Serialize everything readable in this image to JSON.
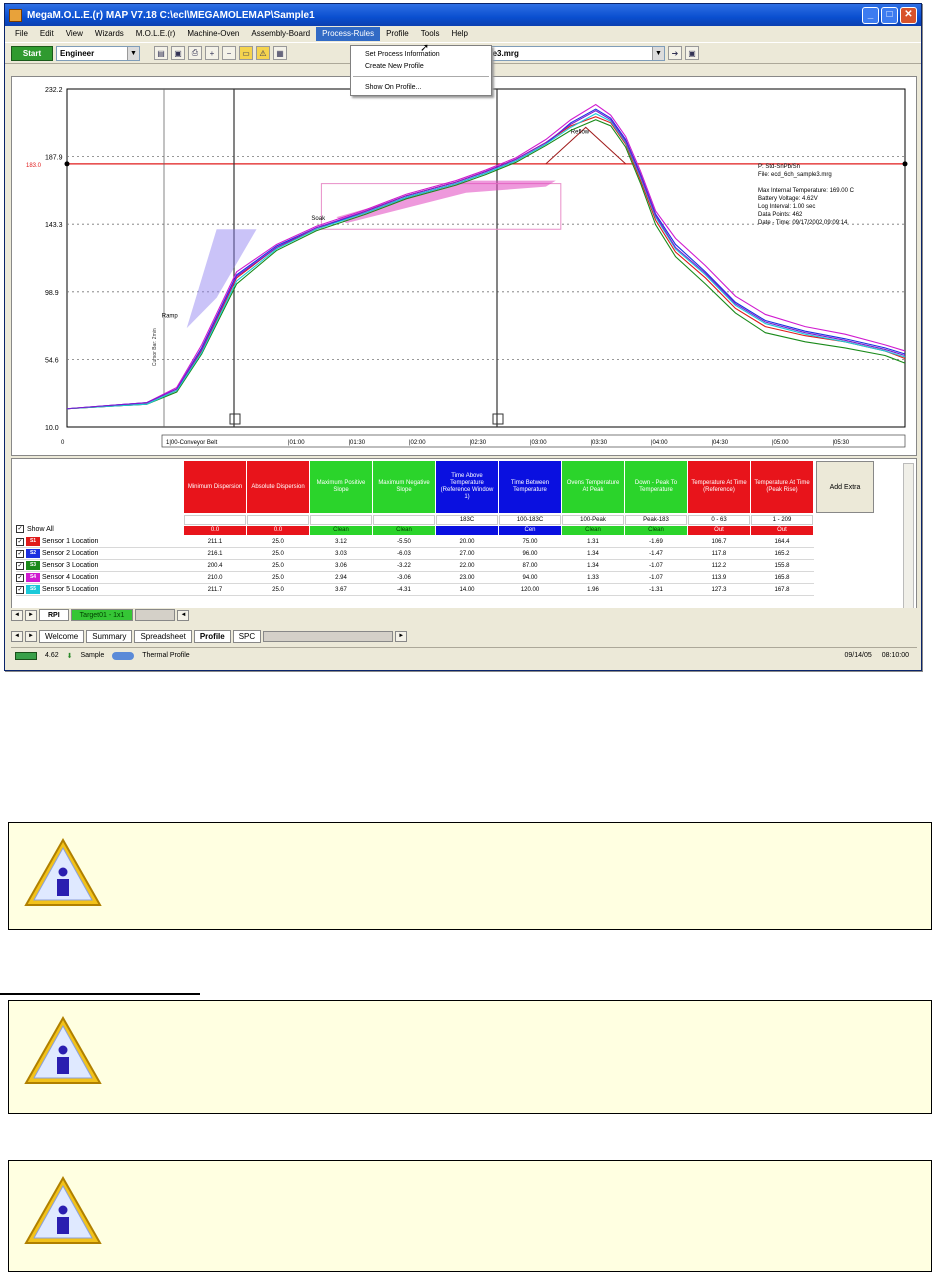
{
  "window": {
    "title": "MegaM.O.L.E.(r) MAP V7.18  C:\\ecl\\MEGAMOLEMAP\\Sample1",
    "menu": [
      "File",
      "Edit",
      "View",
      "Wizards",
      "M.O.L.E.(r)",
      "Machine-Oven",
      "Assembly-Board",
      "Process-Rules",
      "Profile",
      "Tools",
      "Help"
    ],
    "active_menu": "Process-Rules",
    "dropdown": [
      "Set Process Information",
      "Create New Profile",
      "Show On Profile..."
    ],
    "toolbar": {
      "start": "Start",
      "user_combo": "Engineer",
      "file_combo": "ecd_6ch_sample3.mrg"
    }
  },
  "info_panel": [
    "P: Std-SnPb/Sn",
    "File: ecd_6ch_sample3.mrg",
    "",
    "Max Internal Temperature: 169.00 C",
    "Battery Voltage: 4.62V",
    "Log Interval: 1.00 sec",
    "Data Points: 462",
    "Date - Time: 09/17/2002 09:09:14"
  ],
  "chart_data": {
    "type": "line",
    "y_ticks": [
      "232.2",
      "187.9",
      "143.3",
      "98.9",
      "54.6",
      "10.0"
    ],
    "y_red_label": "183.0",
    "x_ticks": [
      "0",
      "|00:00",
      "|01:00",
      "|01:30",
      "|02:00",
      "|02:30",
      "|03:00",
      "|03:30",
      "|04:00",
      "|04:30",
      "|05:00",
      "|05:30"
    ],
    "x_first_tick": "1|00-Conveyor Belt",
    "ylim": [
      10.0,
      232.2
    ],
    "red_line": 183.0,
    "annotations": [
      "Ramp",
      "Soak",
      "Reflow",
      "Cursor Bar: 2min"
    ],
    "series_colors": [
      "#e01b1b",
      "#1b2fe0",
      "#1a8a1a",
      "#d01bd0",
      "#1bc9d9",
      "#7a1bd0"
    ],
    "series": [
      {
        "values": [
          [
            0,
            22
          ],
          [
            80,
            25
          ],
          [
            110,
            34
          ],
          [
            135,
            60
          ],
          [
            170,
            108
          ],
          [
            210,
            128
          ],
          [
            250,
            140
          ],
          [
            300,
            152
          ],
          [
            340,
            162
          ],
          [
            390,
            171
          ],
          [
            420,
            178
          ],
          [
            450,
            186
          ],
          [
            480,
            197
          ],
          [
            505,
            208
          ],
          [
            530,
            214
          ],
          [
            545,
            210
          ],
          [
            560,
            196
          ],
          [
            575,
            172
          ],
          [
            590,
            146
          ],
          [
            610,
            125
          ],
          [
            640,
            108
          ],
          [
            670,
            88
          ],
          [
            700,
            76
          ],
          [
            740,
            70
          ],
          [
            780,
            66
          ],
          [
            820,
            60
          ],
          [
            840,
            55
          ]
        ]
      },
      {
        "values": [
          [
            0,
            22
          ],
          [
            80,
            26
          ],
          [
            110,
            35
          ],
          [
            135,
            62
          ],
          [
            170,
            110
          ],
          [
            210,
            129
          ],
          [
            250,
            141
          ],
          [
            300,
            151
          ],
          [
            340,
            161
          ],
          [
            390,
            170
          ],
          [
            420,
            177
          ],
          [
            450,
            185
          ],
          [
            480,
            196
          ],
          [
            505,
            210
          ],
          [
            530,
            219
          ],
          [
            545,
            213
          ],
          [
            560,
            199
          ],
          [
            575,
            176
          ],
          [
            590,
            150
          ],
          [
            610,
            130
          ],
          [
            640,
            112
          ],
          [
            670,
            92
          ],
          [
            700,
            80
          ],
          [
            740,
            73
          ],
          [
            780,
            68
          ],
          [
            820,
            62
          ],
          [
            840,
            58
          ]
        ]
      },
      {
        "values": [
          [
            0,
            22
          ],
          [
            80,
            25
          ],
          [
            110,
            33
          ],
          [
            135,
            58
          ],
          [
            170,
            104
          ],
          [
            210,
            126
          ],
          [
            250,
            139
          ],
          [
            300,
            150
          ],
          [
            340,
            160
          ],
          [
            390,
            169
          ],
          [
            420,
            176
          ],
          [
            450,
            184
          ],
          [
            480,
            195
          ],
          [
            505,
            205
          ],
          [
            530,
            212
          ],
          [
            545,
            208
          ],
          [
            560,
            194
          ],
          [
            575,
            170
          ],
          [
            590,
            143
          ],
          [
            610,
            122
          ],
          [
            640,
            104
          ],
          [
            670,
            85
          ],
          [
            700,
            72
          ],
          [
            740,
            66
          ],
          [
            780,
            62
          ],
          [
            820,
            57
          ],
          [
            840,
            52
          ]
        ]
      },
      {
        "values": [
          [
            0,
            22
          ],
          [
            80,
            26
          ],
          [
            110,
            36
          ],
          [
            135,
            64
          ],
          [
            170,
            112
          ],
          [
            210,
            130
          ],
          [
            250,
            142
          ],
          [
            300,
            153
          ],
          [
            340,
            163
          ],
          [
            390,
            172
          ],
          [
            420,
            179
          ],
          [
            450,
            187
          ],
          [
            480,
            199
          ],
          [
            505,
            212
          ],
          [
            530,
            222
          ],
          [
            545,
            215
          ],
          [
            560,
            201
          ],
          [
            575,
            178
          ],
          [
            590,
            152
          ],
          [
            610,
            134
          ],
          [
            640,
            116
          ],
          [
            670,
            96
          ],
          [
            700,
            84
          ],
          [
            740,
            76
          ],
          [
            780,
            71
          ],
          [
            820,
            64
          ],
          [
            840,
            60
          ]
        ]
      },
      {
        "values": [
          [
            0,
            22
          ],
          [
            80,
            25
          ],
          [
            110,
            34
          ],
          [
            135,
            59
          ],
          [
            170,
            106
          ],
          [
            210,
            127
          ],
          [
            250,
            140
          ],
          [
            300,
            151
          ],
          [
            340,
            161
          ],
          [
            390,
            170
          ],
          [
            420,
            177
          ],
          [
            450,
            185
          ],
          [
            480,
            196
          ],
          [
            505,
            207
          ],
          [
            530,
            216
          ],
          [
            545,
            211
          ],
          [
            560,
            197
          ],
          [
            575,
            174
          ],
          [
            590,
            148
          ],
          [
            610,
            127
          ],
          [
            640,
            110
          ],
          [
            670,
            90
          ],
          [
            700,
            78
          ],
          [
            740,
            71
          ],
          [
            780,
            66
          ],
          [
            820,
            60
          ],
          [
            840,
            56
          ]
        ]
      },
      {
        "values": [
          [
            0,
            22
          ],
          [
            80,
            26
          ],
          [
            110,
            35
          ],
          [
            135,
            61
          ],
          [
            170,
            109
          ],
          [
            210,
            128
          ],
          [
            250,
            141
          ],
          [
            300,
            152
          ],
          [
            340,
            162
          ],
          [
            390,
            171
          ],
          [
            420,
            178
          ],
          [
            450,
            186
          ],
          [
            480,
            197
          ],
          [
            505,
            209
          ],
          [
            530,
            218
          ],
          [
            545,
            212
          ],
          [
            560,
            198
          ],
          [
            575,
            175
          ],
          [
            590,
            149
          ],
          [
            610,
            128
          ],
          [
            640,
            111
          ],
          [
            670,
            91
          ],
          [
            700,
            79
          ],
          [
            740,
            72
          ],
          [
            780,
            67
          ],
          [
            820,
            61
          ],
          [
            840,
            57
          ]
        ]
      }
    ]
  },
  "table": {
    "headers": [
      {
        "label": "Minimum Dispersion",
        "color": "r"
      },
      {
        "label": "Absolute Dispersion",
        "color": "r"
      },
      {
        "label": "Maximum Positive Slope",
        "color": "g"
      },
      {
        "label": "Maximum Negative Slope",
        "color": "g"
      },
      {
        "label": "Time Above Temperature (Reference Window 1)",
        "color": "b"
      },
      {
        "label": "Time Between Temperature",
        "color": "b"
      },
      {
        "label": "Ovens Temperature At Peak",
        "color": "g"
      },
      {
        "label": "Down - Peak To Temperature",
        "color": "g"
      },
      {
        "label": "Temperature At Time (Reference)",
        "color": "r"
      },
      {
        "label": "Temperature At Time (Peak Rise)",
        "color": "r"
      }
    ],
    "add_extra": "Add Extra",
    "specs": [
      "",
      "",
      "",
      "",
      "183C",
      "100-183C",
      "100-Peak",
      "Peak-183",
      "0 - 63",
      "1 - 209"
    ],
    "stats": [
      {
        "t": "0.0",
        "c": "r"
      },
      {
        "t": "0.0",
        "c": "r"
      },
      {
        "t": "Clean",
        "c": "g"
      },
      {
        "t": "Clean",
        "c": "g"
      },
      {
        "t": "",
        "c": "b"
      },
      {
        "t": "Cen",
        "c": "b"
      },
      {
        "t": "Clean",
        "c": "g"
      },
      {
        "t": "Clean",
        "c": "g"
      },
      {
        "t": "Out",
        "c": "r"
      },
      {
        "t": "Out",
        "c": "r"
      }
    ],
    "show_all": "Show All",
    "rows": [
      {
        "sw": "S1",
        "color": "#e01b1b",
        "label": "Sensor 1 Location",
        "values": [
          "211.1",
          "25.0",
          "3.12",
          "-5.50",
          "20.00",
          "75.00",
          "1.31",
          "-1.69",
          "106.7",
          "164.4"
        ]
      },
      {
        "sw": "S2",
        "color": "#1b2fe0",
        "label": "Sensor 2 Location",
        "values": [
          "216.1",
          "25.0",
          "3.03",
          "-6.03",
          "27.00",
          "96.00",
          "1.34",
          "-1.47",
          "117.8",
          "165.2"
        ]
      },
      {
        "sw": "S3",
        "color": "#1a8a1a",
        "label": "Sensor 3 Location",
        "values": [
          "200.4",
          "25.0",
          "3.06",
          "-3.22",
          "22.00",
          "87.00",
          "1.34",
          "-1.07",
          "112.2",
          "155.8"
        ]
      },
      {
        "sw": "S4",
        "color": "#d01bd0",
        "label": "Sensor 4 Location",
        "values": [
          "210.0",
          "25.0",
          "2.94",
          "-3.06",
          "23.00",
          "94.00",
          "1.33",
          "-1.07",
          "113.9",
          "165.8"
        ]
      },
      {
        "sw": "S5",
        "color": "#1bc9d9",
        "label": "Sensor 5 Location",
        "values": [
          "211.7",
          "25.0",
          "3.67",
          "-4.31",
          "14.00",
          "120.00",
          "1.96",
          "-1.31",
          "127.3",
          "167.8"
        ]
      }
    ]
  },
  "sheet_tabs": [
    "RPI",
    "Target01 - 1x1",
    ""
  ],
  "doc_tabs": [
    "Welcome",
    "Summary",
    "Spreadsheet",
    "Profile",
    "SPC"
  ],
  "active_doc_tab": "Profile",
  "status": {
    "voltage": "4.62",
    "sample": "Sample",
    "mode": "Thermal Profile",
    "date": "09/14/05",
    "time": "08:10:00"
  },
  "notes": [
    "",
    "",
    ""
  ]
}
